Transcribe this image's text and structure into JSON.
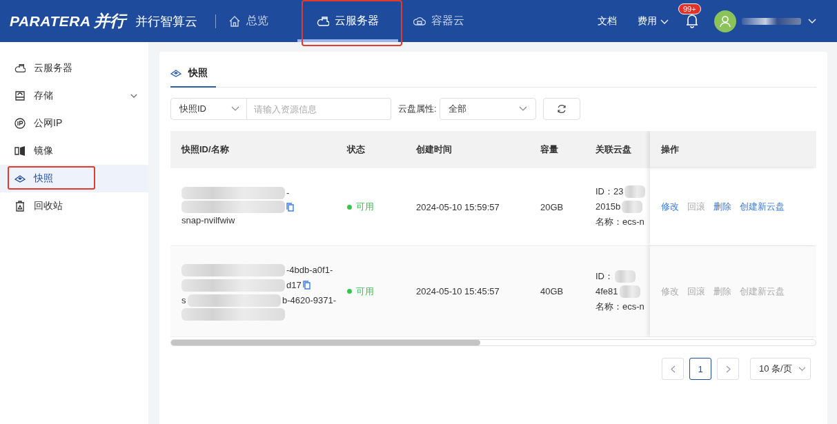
{
  "header": {
    "brand": "PARATERA",
    "brand_cn": "并行",
    "product": "并行智算云",
    "nav": [
      {
        "label": "总览",
        "selected": false
      },
      {
        "label": "云服务器",
        "selected": true
      },
      {
        "label": "容器云",
        "selected": false
      }
    ],
    "links": [
      {
        "label": "文档",
        "dropdown": false
      },
      {
        "label": "费用",
        "dropdown": true
      }
    ],
    "notification_badge": "99+"
  },
  "sidebar": {
    "items": [
      {
        "label": "云服务器",
        "selected": false,
        "expandable": false
      },
      {
        "label": "存储",
        "selected": false,
        "expandable": true
      },
      {
        "label": "公网IP",
        "selected": false,
        "expandable": false
      },
      {
        "label": "镜像",
        "selected": false,
        "expandable": false
      },
      {
        "label": "快照",
        "selected": true,
        "expandable": false
      },
      {
        "label": "回收站",
        "selected": false,
        "expandable": false
      }
    ]
  },
  "tabs": [
    {
      "label": "快照",
      "selected": true
    }
  ],
  "filter": {
    "field": "快照ID",
    "placeholder": "请输入资源信息",
    "attr_label": "云盘属性:",
    "attr_value": "全部"
  },
  "table": {
    "columns": [
      "快照ID/名称",
      "状态",
      "创建时间",
      "容量",
      "关联云盘",
      "操作"
    ],
    "rows": [
      {
        "id_lines": [
          [
            {
              "kind": "blur"
            },
            {
              "kind": "text",
              "text": "-"
            }
          ],
          [
            {
              "kind": "blur"
            },
            {
              "kind": "copy"
            }
          ],
          [
            {
              "kind": "text",
              "text": "snap-nvilfwiw"
            }
          ]
        ],
        "status": "可用",
        "created": "2024-05-10 15:59:57",
        "size": "20GB",
        "disk_lines": [
          [
            {
              "kind": "text",
              "text": "ID：23"
            },
            {
              "kind": "blur"
            }
          ],
          [
            {
              "kind": "text",
              "text": "2015b"
            },
            {
              "kind": "blur"
            }
          ],
          [
            {
              "kind": "text",
              "text": "名称：ecs-n"
            }
          ]
        ],
        "actions": [
          {
            "label": "修改",
            "disabled": false
          },
          {
            "label": "回滚",
            "disabled": true
          },
          {
            "label": "删除",
            "disabled": false
          },
          {
            "label": "创建新云盘",
            "disabled": false
          }
        ]
      },
      {
        "id_lines": [
          [
            {
              "kind": "blur"
            },
            {
              "kind": "text",
              "text": "-4bdb-a0f1-"
            }
          ],
          [
            {
              "kind": "blur"
            },
            {
              "kind": "text",
              "text": "d17"
            },
            {
              "kind": "copy"
            }
          ],
          [
            {
              "kind": "text",
              "text": "s"
            },
            {
              "kind": "blur"
            },
            {
              "kind": "text",
              "text": "b-4620-9371-"
            }
          ],
          [
            {
              "kind": "blur"
            }
          ]
        ],
        "status": "可用",
        "created": "2024-05-10 15:45:57",
        "size": "40GB",
        "disk_lines": [
          [
            {
              "kind": "text",
              "text": "ID："
            },
            {
              "kind": "blur"
            }
          ],
          [
            {
              "kind": "text",
              "text": "4fe81"
            },
            {
              "kind": "blur"
            }
          ],
          [
            {
              "kind": "text",
              "text": "名称：ecs-n"
            }
          ]
        ],
        "actions": [
          {
            "label": "修改",
            "disabled": true
          },
          {
            "label": "回滚",
            "disabled": true
          },
          {
            "label": "删除",
            "disabled": true
          },
          {
            "label": "创建新云盘",
            "disabled": true
          }
        ]
      }
    ]
  },
  "pagination": {
    "pages": [
      {
        "label": "1",
        "selected": true
      }
    ],
    "page_size": "10 条/页"
  }
}
